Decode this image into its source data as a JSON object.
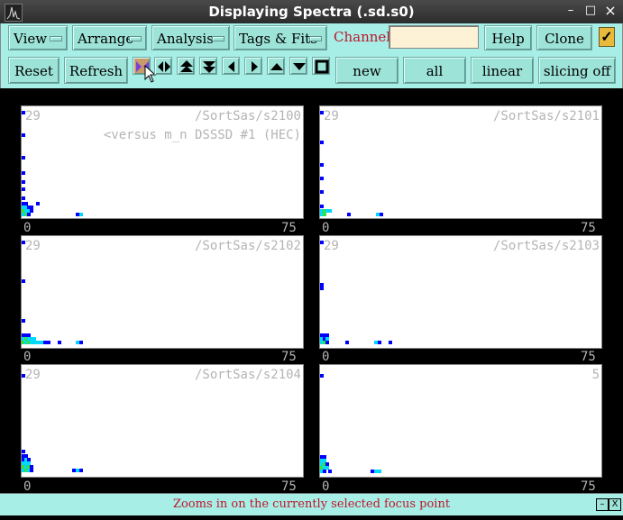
{
  "window": {
    "title": "Displaying Spectra (.sd.s0)",
    "minimize": "–",
    "maximize": "□",
    "close": "×"
  },
  "menus": {
    "view": "View",
    "arrange": "Arrange",
    "analysis": "Analysis",
    "tags": "Tags & Fits"
  },
  "channel": {
    "label": "Channel:",
    "value": ""
  },
  "buttons": {
    "help": "Help",
    "clone": "Clone",
    "reset": "Reset",
    "refresh": "Refresh",
    "new": "new",
    "all": "all",
    "linear": "linear",
    "slicing": "slicing off"
  },
  "checkbox": {
    "checked": true,
    "mark": "✓"
  },
  "panels": [
    {
      "count": "29",
      "path": "/SortSas/s2100",
      "subtitle": "<versus m_n DSSSD #1 (HEC)",
      "xmin": "0",
      "xmax": "75"
    },
    {
      "count": "29",
      "path": "/SortSas/s2101",
      "subtitle": "",
      "xmin": "0",
      "xmax": "75"
    },
    {
      "count": "29",
      "path": "/SortSas/s2102",
      "subtitle": "",
      "xmin": "0",
      "xmax": "75"
    },
    {
      "count": "29",
      "path": "/SortSas/s2103",
      "subtitle": "",
      "xmin": "0",
      "xmax": "75"
    },
    {
      "count": "29",
      "path": "/SortSas/s2104",
      "subtitle": "",
      "xmin": "0",
      "xmax": "75"
    },
    {
      "count": "",
      "path": "5",
      "subtitle": "",
      "xmin": "0",
      "xmax": "75"
    }
  ],
  "status": {
    "text": "Zooms in on the currently selected focus point",
    "min": "–",
    "close": "X"
  },
  "colors": {
    "toolbar": "#a6eee6",
    "button": "#9de3d8",
    "accent_red": "#c0152a",
    "input": "#fdf2d6",
    "blue": "#0000ff",
    "cyan": "#00d8ff",
    "green": "#38e03a"
  },
  "icons": [
    "zoom-focus-icon",
    "expand-horizontal-icon",
    "double-up-icon",
    "double-down-icon",
    "left-icon",
    "right-icon",
    "up-icon",
    "down-icon",
    "square-icon"
  ]
}
